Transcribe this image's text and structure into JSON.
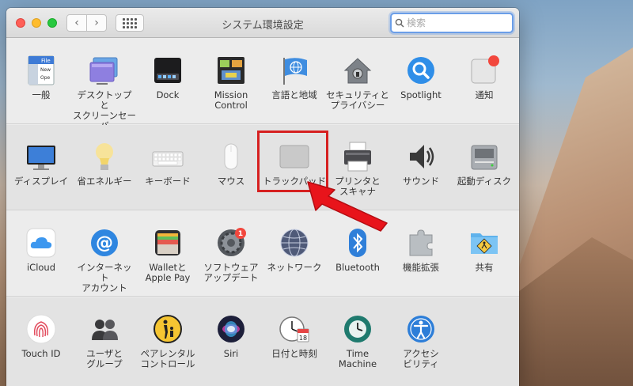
{
  "window": {
    "title": "システム環境設定",
    "search_placeholder": "検索"
  },
  "sections": [
    {
      "panes": [
        {
          "label": "一般",
          "icon": "general-icon"
        },
        {
          "label": "デスクトップと\nスクリーンセーバ",
          "icon": "desktop-screensaver-icon"
        },
        {
          "label": "Dock",
          "icon": "dock-icon"
        },
        {
          "label": "Mission\nControl",
          "icon": "mission-control-icon"
        },
        {
          "label": "言語と地域",
          "icon": "language-region-icon"
        },
        {
          "label": "セキュリティと\nプライバシー",
          "icon": "security-house-icon"
        },
        {
          "label": "Spotlight",
          "icon": "spotlight-icon"
        },
        {
          "label": "通知",
          "icon": "notifications-icon"
        }
      ]
    },
    {
      "panes": [
        {
          "label": "ディスプレイ",
          "icon": "display-icon"
        },
        {
          "label": "省エネルギー",
          "icon": "energy-saver-bulb-icon"
        },
        {
          "label": "キーボード",
          "icon": "keyboard-icon"
        },
        {
          "label": "マウス",
          "icon": "mouse-icon"
        },
        {
          "label": "トラックパッド",
          "icon": "trackpad-icon"
        },
        {
          "label": "プリンタと\nスキャナ",
          "icon": "printer-icon"
        },
        {
          "label": "サウンド",
          "icon": "speaker-icon"
        },
        {
          "label": "起動ディスク",
          "icon": "startup-disk-icon"
        }
      ]
    },
    {
      "panes": [
        {
          "label": "iCloud",
          "icon": "icloud-icon"
        },
        {
          "label": "インターネット\nアカウント",
          "icon": "internet-accounts-at-icon"
        },
        {
          "label": "Walletと\nApple Pay",
          "icon": "wallet-icon"
        },
        {
          "label": "ソフトウェア\nアップデート",
          "icon": "software-update-gear-icon",
          "badge": "1"
        },
        {
          "label": "ネットワーク",
          "icon": "network-globe-icon"
        },
        {
          "label": "Bluetooth",
          "icon": "bluetooth-icon"
        },
        {
          "label": "機能拡張",
          "icon": "extensions-puzzle-icon"
        },
        {
          "label": "共有",
          "icon": "sharing-folder-icon"
        }
      ]
    },
    {
      "panes": [
        {
          "label": "Touch ID",
          "icon": "fingerprint-icon"
        },
        {
          "label": "ユーザと\nグループ",
          "icon": "users-groups-icon"
        },
        {
          "label": "ペアレンタル\nコントロール",
          "icon": "parental-controls-icon"
        },
        {
          "label": "Siri",
          "icon": "siri-icon"
        },
        {
          "label": "日付と時刻",
          "icon": "date-time-clock-icon",
          "calendar_day": "18"
        },
        {
          "label": "Time\nMachine",
          "icon": "time-machine-icon"
        },
        {
          "label": "アクセシ\nビリティ",
          "icon": "accessibility-icon"
        }
      ]
    }
  ],
  "colors": {
    "highlight_box": "#d62020",
    "arrow": "#e8141b",
    "search_focus": "#6b9ee8"
  }
}
